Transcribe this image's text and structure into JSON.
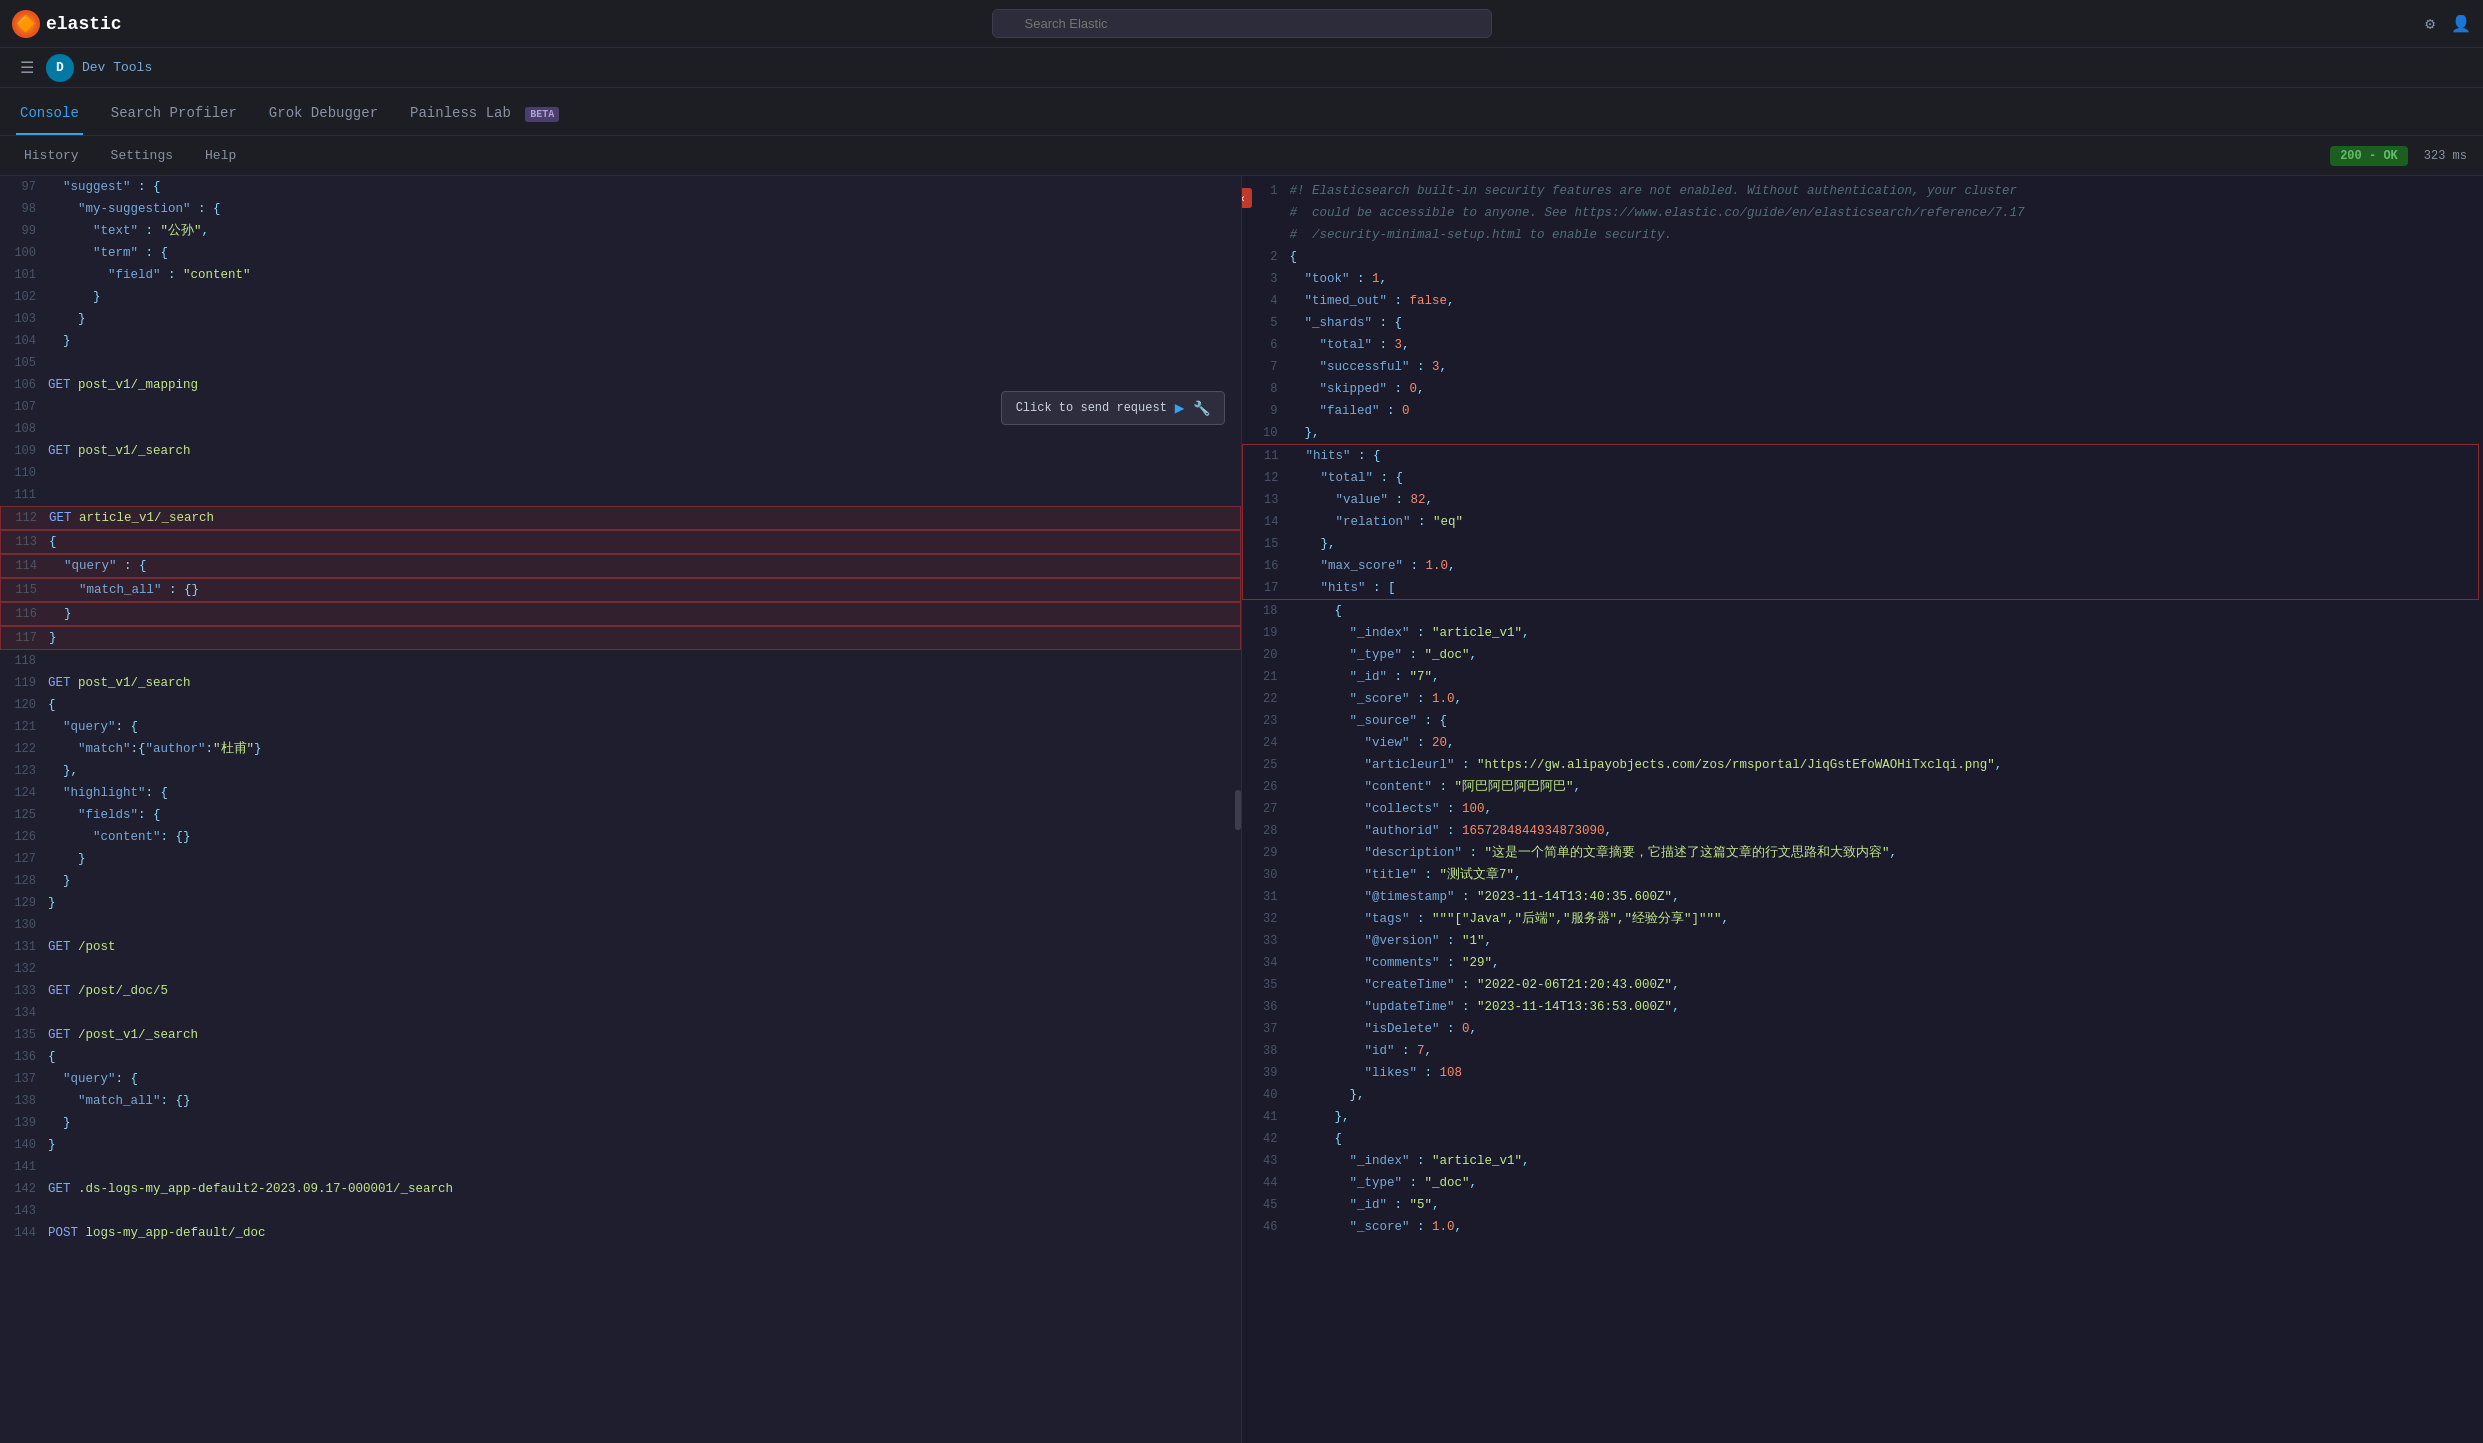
{
  "topNav": {
    "logoText": "elastic",
    "searchPlaceholder": "Search Elastic"
  },
  "breadcrumb": {
    "appName": "Dev Tools"
  },
  "tabs": [
    {
      "id": "console",
      "label": "Console",
      "active": true
    },
    {
      "id": "search-profiler",
      "label": "Search Profiler",
      "active": false
    },
    {
      "id": "grok-debugger",
      "label": "Grok Debugger",
      "active": false
    },
    {
      "id": "painless-lab",
      "label": "Painless Lab",
      "active": false,
      "beta": true
    }
  ],
  "toolbar": {
    "historyLabel": "History",
    "settingsLabel": "Settings",
    "helpLabel": "Help",
    "statusCode": "200 - OK",
    "responseTime": "323 ms"
  },
  "editor": {
    "lines": [
      {
        "num": "97",
        "content": "  \"suggest\" : {"
      },
      {
        "num": "98",
        "content": "    \"my-suggestion\" : {"
      },
      {
        "num": "99",
        "content": "      \"text\" : \"公孙\","
      },
      {
        "num": "100",
        "content": "      \"term\" : {"
      },
      {
        "num": "101",
        "content": "        \"field\" : \"content\""
      },
      {
        "num": "102",
        "content": "      }"
      },
      {
        "num": "103",
        "content": "    }"
      },
      {
        "num": "104",
        "content": "  }"
      },
      {
        "num": "105",
        "content": ""
      },
      {
        "num": "106",
        "content": "GET post_v1/_mapping"
      },
      {
        "num": "107",
        "content": ""
      },
      {
        "num": "108",
        "content": ""
      },
      {
        "num": "109",
        "content": "GET post_v1/_search"
      },
      {
        "num": "110",
        "content": ""
      },
      {
        "num": "111",
        "content": ""
      },
      {
        "num": "112",
        "content": "GET article_v1/_search",
        "highlighted": true
      },
      {
        "num": "113",
        "content": "{",
        "highlighted": true
      },
      {
        "num": "114",
        "content": "  \"query\" : {",
        "highlighted": true
      },
      {
        "num": "115",
        "content": "    \"match_all\" : {}",
        "highlighted": true
      },
      {
        "num": "116",
        "content": "  }",
        "highlighted": true
      },
      {
        "num": "117",
        "content": "}",
        "highlighted": true
      },
      {
        "num": "118",
        "content": ""
      },
      {
        "num": "119",
        "content": "GET post_v1/_search"
      },
      {
        "num": "120",
        "content": "{"
      },
      {
        "num": "121",
        "content": "  \"query\": {"
      },
      {
        "num": "122",
        "content": "    \"match\":{\"author\":\"杜甫\"}"
      },
      {
        "num": "123",
        "content": "  },"
      },
      {
        "num": "124",
        "content": "  \"highlight\": {"
      },
      {
        "num": "125",
        "content": "    \"fields\": {"
      },
      {
        "num": "126",
        "content": "      \"content\": {}"
      },
      {
        "num": "127",
        "content": "    }"
      },
      {
        "num": "128",
        "content": "  }"
      },
      {
        "num": "129",
        "content": "}"
      },
      {
        "num": "130",
        "content": ""
      },
      {
        "num": "131",
        "content": "GET /post"
      },
      {
        "num": "132",
        "content": ""
      },
      {
        "num": "133",
        "content": "GET /post/_doc/5"
      },
      {
        "num": "134",
        "content": ""
      },
      {
        "num": "135",
        "content": "GET /post_v1/_search"
      },
      {
        "num": "136",
        "content": "{"
      },
      {
        "num": "137",
        "content": "  \"query\": {"
      },
      {
        "num": "138",
        "content": "    \"match_all\": {}"
      },
      {
        "num": "139",
        "content": "  }"
      },
      {
        "num": "140",
        "content": "}"
      },
      {
        "num": "141",
        "content": ""
      },
      {
        "num": "142",
        "content": "GET .ds-logs-my_app-default2-2023.09.17-000001/_search"
      },
      {
        "num": "143",
        "content": ""
      },
      {
        "num": "144",
        "content": "POST logs-my_app-default/_doc"
      }
    ]
  },
  "output": {
    "lines": [
      {
        "num": "1",
        "content": "#! Elasticsearch built-in security features are not enabled. Without authentication, your cluster",
        "type": "comment"
      },
      {
        "num": "",
        "content": "#  could be accessible to anyone. See https://www.elastic.co/guide/en/elasticsearch/reference/7.17",
        "type": "comment"
      },
      {
        "num": "",
        "content": "#  /security-minimal-setup.html to enable security.",
        "type": "comment"
      },
      {
        "num": "2",
        "content": "{",
        "type": "normal"
      },
      {
        "num": "3",
        "content": "  \"took\" : 1,",
        "type": "normal"
      },
      {
        "num": "4",
        "content": "  \"timed_out\" : false,",
        "type": "normal"
      },
      {
        "num": "5",
        "content": "  \"_shards\" : {",
        "type": "normal"
      },
      {
        "num": "6",
        "content": "    \"total\" : 3,",
        "type": "normal"
      },
      {
        "num": "7",
        "content": "    \"successful\" : 3,",
        "type": "normal"
      },
      {
        "num": "8",
        "content": "    \"skipped\" : 0,",
        "type": "normal"
      },
      {
        "num": "9",
        "content": "    \"failed\" : 0",
        "type": "normal"
      },
      {
        "num": "10",
        "content": "  },",
        "type": "normal"
      },
      {
        "num": "11",
        "content": "  \"hits\" : {",
        "type": "highlighted"
      },
      {
        "num": "12",
        "content": "    \"total\" : {",
        "type": "highlighted"
      },
      {
        "num": "13",
        "content": "      \"value\" : 82,",
        "type": "highlighted"
      },
      {
        "num": "14",
        "content": "      \"relation\" : \"eq\"",
        "type": "highlighted"
      },
      {
        "num": "15",
        "content": "    },",
        "type": "highlighted"
      },
      {
        "num": "16",
        "content": "    \"max_score\" : 1.0,",
        "type": "highlighted"
      },
      {
        "num": "17",
        "content": "    \"hits\" : [",
        "type": "highlighted"
      },
      {
        "num": "18",
        "content": "      {",
        "type": "normal"
      },
      {
        "num": "19",
        "content": "        \"_index\" : \"article_v1\",",
        "type": "normal"
      },
      {
        "num": "20",
        "content": "        \"_type\" : \"_doc\",",
        "type": "normal"
      },
      {
        "num": "21",
        "content": "        \"_id\" : \"7\",",
        "type": "normal"
      },
      {
        "num": "22",
        "content": "        \"_score\" : 1.0,",
        "type": "normal"
      },
      {
        "num": "23",
        "content": "        \"_source\" : {",
        "type": "normal"
      },
      {
        "num": "24",
        "content": "          \"view\" : 20,",
        "type": "normal"
      },
      {
        "num": "25",
        "content": "          \"articleurl\" : \"https://gw.alipayobjects.com/zos/rmsportal/JiqGstEfoWAOHiTxclqi.png\",",
        "type": "normal"
      },
      {
        "num": "26",
        "content": "          \"content\" : \"阿巴阿巴阿巴阿巴\",",
        "type": "normal"
      },
      {
        "num": "27",
        "content": "          \"collects\" : 100,",
        "type": "normal"
      },
      {
        "num": "28",
        "content": "          \"authorid\" : 1657284844934873090,",
        "type": "normal"
      },
      {
        "num": "29",
        "content": "          \"description\" : \"这是一个简单的文章摘要，它描述了这篇文章的行文思路和大致内容\",",
        "type": "normal"
      },
      {
        "num": "30",
        "content": "          \"title\" : \"测试文章7\",",
        "type": "normal"
      },
      {
        "num": "31",
        "content": "          \"@timestamp\" : \"2023-11-14T13:40:35.600Z\",",
        "type": "normal"
      },
      {
        "num": "32",
        "content": "          \"tags\" : \"\"\"[\"Java\",\"后端\",\"服务器\",\"经验分享\"]\"\"\",",
        "type": "normal"
      },
      {
        "num": "33",
        "content": "          \"@version\" : \"1\",",
        "type": "normal"
      },
      {
        "num": "34",
        "content": "          \"comments\" : \"29\",",
        "type": "normal"
      },
      {
        "num": "35",
        "content": "          \"createTime\" : \"2022-02-06T21:20:43.000Z\",",
        "type": "normal"
      },
      {
        "num": "36",
        "content": "          \"updateTime\" : \"2023-11-14T13:36:53.000Z\",",
        "type": "normal"
      },
      {
        "num": "37",
        "content": "          \"isDelete\" : 0,",
        "type": "normal"
      },
      {
        "num": "38",
        "content": "          \"id\" : 7,",
        "type": "normal"
      },
      {
        "num": "39",
        "content": "          \"likes\" : 108",
        "type": "normal"
      },
      {
        "num": "40",
        "content": "        },",
        "type": "normal"
      },
      {
        "num": "41",
        "content": "      },",
        "type": "normal"
      },
      {
        "num": "42",
        "content": "      {",
        "type": "normal"
      },
      {
        "num": "43",
        "content": "        \"_index\" : \"article_v1\",",
        "type": "normal"
      },
      {
        "num": "44",
        "content": "        \"_type\" : \"_doc\",",
        "type": "normal"
      },
      {
        "num": "45",
        "content": "        \"_id\" : \"5\",",
        "type": "normal"
      },
      {
        "num": "46",
        "content": "        \"_score\" : 1.0,",
        "type": "normal"
      }
    ]
  },
  "tooltip": {
    "text": "Click to send request"
  }
}
